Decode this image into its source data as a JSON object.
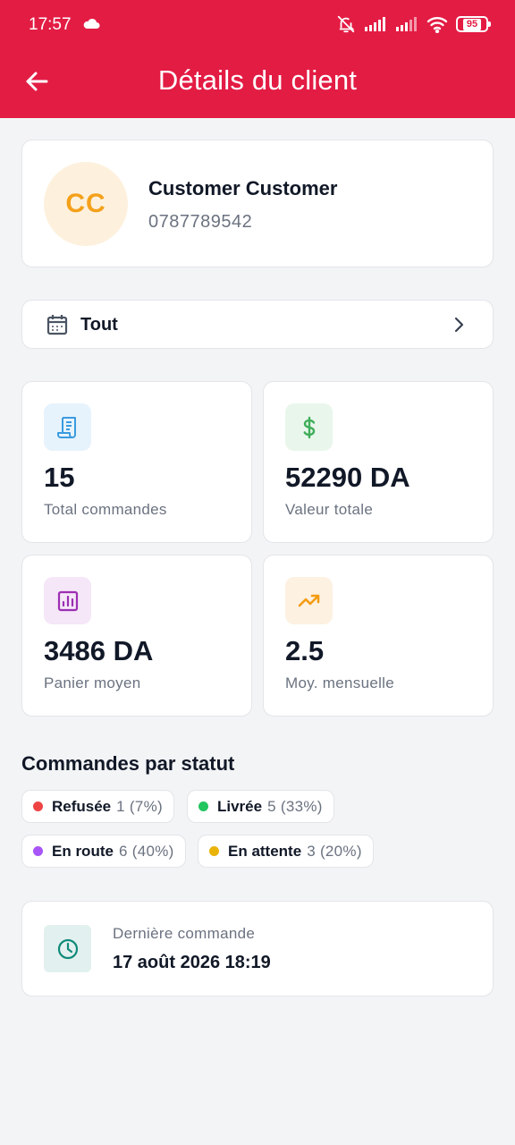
{
  "status_bar": {
    "time": "17:57",
    "battery": "95",
    "icons": [
      "cloud-icon",
      "bell-off-icon",
      "signal-icon",
      "signal-icon",
      "wifi-icon",
      "battery-icon"
    ]
  },
  "header": {
    "title": "Détails du client",
    "back_icon": "arrow-left-icon",
    "background": "#e31c44"
  },
  "customer": {
    "initials": "CC",
    "name": "Customer Customer",
    "phone": "0787789542"
  },
  "period": {
    "label": "Tout",
    "icon": "calendar-icon"
  },
  "stats": [
    {
      "value": "15",
      "label": "Total commandes",
      "icon": "receipt-icon",
      "color": "#3b9bdf"
    },
    {
      "value": "52290 DA",
      "label": "Valeur totale",
      "icon": "dollar-icon",
      "color": "#3fae5a"
    },
    {
      "value": "3486 DA",
      "label": "Panier moyen",
      "icon": "bar-chart-icon",
      "color": "#9c2fb3"
    },
    {
      "value": "2.5",
      "label": "Moy. mensuelle",
      "icon": "trending-up-icon",
      "color": "#f39c12"
    }
  ],
  "orders_by_status": {
    "title": "Commandes par statut",
    "items": [
      {
        "label": "Refusée",
        "count": "1 (7%)",
        "color": "#ef4444"
      },
      {
        "label": "Livrée",
        "count": "5 (33%)",
        "color": "#22c55e"
      },
      {
        "label": "En route",
        "count": "6 (40%)",
        "color": "#a855f7"
      },
      {
        "label": "En attente",
        "count": "3 (20%)",
        "color": "#eab308"
      }
    ]
  },
  "last_order": {
    "label": "Dernière commande",
    "date": "17 août 2026 18:19",
    "icon": "clock-icon"
  }
}
